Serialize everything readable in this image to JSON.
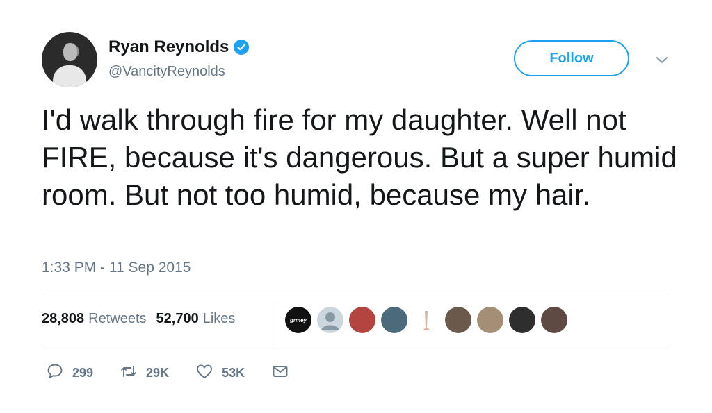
{
  "tweet": {
    "author": {
      "name": "Ryan Reynolds",
      "handle": "@VancityReynolds",
      "verified": true
    },
    "follow_label": "Follow",
    "text": "I'd walk through fire for my daughter. Well not FIRE, because it's dangerous. But a super humid room. But not too humid, because my hair.",
    "timestamp": "1:33 PM - 11 Sep 2015",
    "stats": {
      "retweets_count": "28,808",
      "retweets_label": "Retweets",
      "likes_count": "52,700",
      "likes_label": "Likes"
    },
    "likers": [
      {
        "label": "grmey",
        "color": "#111111"
      },
      {
        "label": "",
        "color": "#ccd6dd"
      },
      {
        "label": "",
        "color": "#b3443f"
      },
      {
        "label": "",
        "color": "#4b6a7c"
      },
      {
        "label": "",
        "color": "#ffffff"
      },
      {
        "label": "",
        "color": "#6b5a4c"
      },
      {
        "label": "",
        "color": "#a58e76"
      },
      {
        "label": "",
        "color": "#2e2e2e"
      },
      {
        "label": "",
        "color": "#5e4a42"
      }
    ],
    "actions": {
      "reply_count": "299",
      "retweet_count": "29K",
      "like_count": "53K"
    }
  },
  "colors": {
    "accent": "#1da1f2",
    "muted": "#657786",
    "text": "#14171a",
    "divider": "#e1e8ed"
  }
}
